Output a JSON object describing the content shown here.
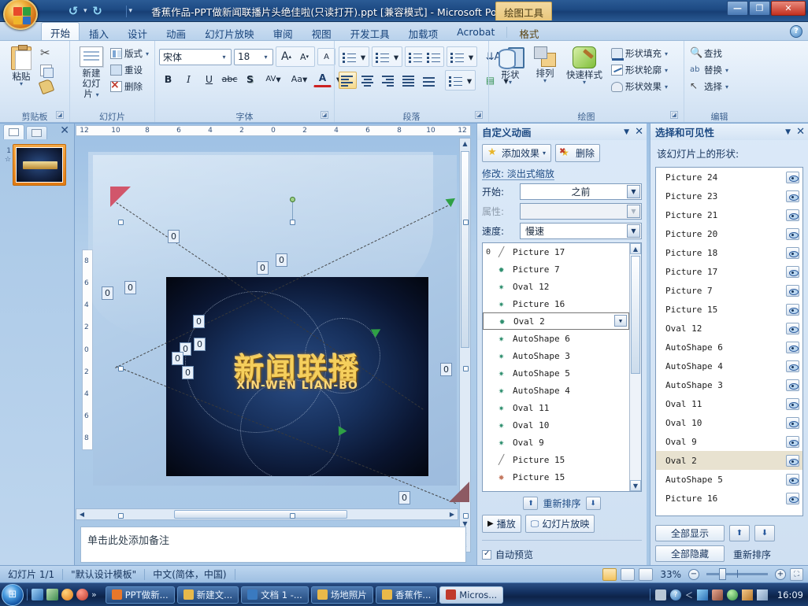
{
  "titlebar": {
    "document_title": "香蕉作品-PPT做新闻联播片头绝佳啦(只读打开).ppt [兼容模式] - Microsoft PowerPoi...",
    "contextual_tab": "绘图工具",
    "quick_access": [
      "save-icon",
      "undo-icon",
      "redo-icon",
      "new-icon"
    ],
    "minimize": "—",
    "restore": "❐",
    "close": "✕"
  },
  "tabs": [
    {
      "label": "开始",
      "active": true
    },
    {
      "label": "插入",
      "active": false
    },
    {
      "label": "设计",
      "active": false
    },
    {
      "label": "动画",
      "active": false
    },
    {
      "label": "幻灯片放映",
      "active": false
    },
    {
      "label": "审阅",
      "active": false
    },
    {
      "label": "视图",
      "active": false
    },
    {
      "label": "开发工具",
      "active": false
    },
    {
      "label": "加载项",
      "active": false
    },
    {
      "label": "Acrobat",
      "active": false
    },
    {
      "label": "格式",
      "active": false
    }
  ],
  "ribbon": {
    "clipboard": {
      "group_label": "剪贴板",
      "paste": "粘贴",
      "cut": "剪切",
      "copy": "复制",
      "format_painter": "格式刷"
    },
    "slides": {
      "group_label": "幻灯片",
      "new_slide_line1": "新建",
      "new_slide_line2": "幻灯片",
      "layout": "版式",
      "reset": "重设",
      "delete": "删除"
    },
    "font": {
      "group_label": "字体",
      "font_name": "宋体",
      "font_size": "18",
      "grow": "A",
      "shrink": "A",
      "clear_format": "A",
      "bold": "B",
      "italic": "I",
      "underline": "U",
      "strike": "abc",
      "shadow": "S",
      "spacing": "AV",
      "case": "Aa",
      "color": "A"
    },
    "paragraph": {
      "group_label": "段落"
    },
    "drawing": {
      "group_label": "绘图",
      "shapes": "形状",
      "arrange": "排列",
      "quick_styles": "快速样式",
      "shape_fill": "形状填充",
      "shape_outline": "形状轮廓",
      "shape_effects": "形状效果"
    },
    "editing": {
      "group_label": "编辑",
      "find": "查找",
      "replace": "替换",
      "select": "选择"
    }
  },
  "slides_pane": {
    "tab_slides": "slides-tab",
    "tab_outline": "outline-tab",
    "close": "✕",
    "thumbnails": [
      {
        "number": "1",
        "title": "新闻联播"
      }
    ]
  },
  "editor": {
    "h_ruler_ticks": [
      "12",
      "10",
      "8",
      "6",
      "4",
      "2",
      "0",
      "2",
      "4",
      "6",
      "8",
      "10",
      "12"
    ],
    "v_ruler_ticks": [
      "8",
      "6",
      "4",
      "2",
      "0",
      "2",
      "4",
      "6",
      "8"
    ],
    "slide": {
      "picture_title": "新闻联播",
      "picture_subtitle": "XIN-WEN LIAN-BO"
    },
    "animation_badges": [
      "0",
      "0",
      "0",
      "0",
      "0",
      "0",
      "0",
      "0",
      "0",
      "0",
      "0",
      "0"
    ],
    "notes_placeholder": "单击此处添加备注"
  },
  "animation_pane": {
    "title": "自定义动画",
    "collapse": "▼",
    "close": "✕",
    "add_effect": "添加效果",
    "remove": "删除",
    "modify_label": "修改: 淡出式缩放",
    "start_label": "开始:",
    "start_value": "之前",
    "property_label": "属性:",
    "property_value": "",
    "speed_label": "速度:",
    "speed_value": "慢速",
    "items": [
      {
        "order": "0",
        "name": "Picture 17",
        "icon": "motion-path-icon",
        "selected": false
      },
      {
        "order": "",
        "name": "Picture 7",
        "icon": "emphasis-star-icon",
        "selected": false
      },
      {
        "order": "",
        "name": "Oval 12",
        "icon": "entrance-star-icon",
        "selected": false
      },
      {
        "order": "",
        "name": "Picture 16",
        "icon": "entrance-star-icon",
        "selected": false
      },
      {
        "order": "",
        "name": "Oval 2",
        "icon": "emphasis-star-icon",
        "selected": true
      },
      {
        "order": "",
        "name": "AutoShape 6",
        "icon": "entrance-star-icon",
        "selected": false
      },
      {
        "order": "",
        "name": "AutoShape 3",
        "icon": "entrance-star-icon",
        "selected": false
      },
      {
        "order": "",
        "name": "AutoShape 5",
        "icon": "entrance-star-icon",
        "selected": false
      },
      {
        "order": "",
        "name": "AutoShape 4",
        "icon": "entrance-star-icon",
        "selected": false
      },
      {
        "order": "",
        "name": "Oval 11",
        "icon": "entrance-star-icon",
        "selected": false
      },
      {
        "order": "",
        "name": "Oval 10",
        "icon": "entrance-star-icon",
        "selected": false
      },
      {
        "order": "",
        "name": "Oval 9",
        "icon": "entrance-star-icon",
        "selected": false
      },
      {
        "order": "",
        "name": "Picture 15",
        "icon": "motion-path-icon",
        "selected": false
      },
      {
        "order": "",
        "name": "Picture 15",
        "icon": "exit-star-icon",
        "selected": false
      }
    ],
    "reorder_label": "重新排序",
    "play": "播放",
    "slideshow": "幻灯片放映",
    "autopreview": "自动预览"
  },
  "selection_pane": {
    "title": "选择和可见性",
    "collapse": "▼",
    "close": "✕",
    "subtitle": "该幻灯片上的形状:",
    "shapes": [
      {
        "name": "Picture 24",
        "visible": true,
        "highlighted": false
      },
      {
        "name": "Picture 23",
        "visible": true,
        "highlighted": false
      },
      {
        "name": "Picture 21",
        "visible": true,
        "highlighted": false
      },
      {
        "name": "Picture 20",
        "visible": true,
        "highlighted": false
      },
      {
        "name": "Picture 18",
        "visible": true,
        "highlighted": false
      },
      {
        "name": "Picture 17",
        "visible": true,
        "highlighted": false
      },
      {
        "name": "Picture 7",
        "visible": true,
        "highlighted": false
      },
      {
        "name": "Picture 15",
        "visible": true,
        "highlighted": false
      },
      {
        "name": "Oval 12",
        "visible": true,
        "highlighted": false
      },
      {
        "name": "AutoShape 6",
        "visible": true,
        "highlighted": false
      },
      {
        "name": "AutoShape 4",
        "visible": true,
        "highlighted": false
      },
      {
        "name": "AutoShape 3",
        "visible": true,
        "highlighted": false
      },
      {
        "name": "Oval 11",
        "visible": true,
        "highlighted": false
      },
      {
        "name": "Oval 10",
        "visible": true,
        "highlighted": false
      },
      {
        "name": "Oval 9",
        "visible": true,
        "highlighted": false
      },
      {
        "name": "Oval 2",
        "visible": true,
        "highlighted": true
      },
      {
        "name": "AutoShape 5",
        "visible": true,
        "highlighted": false
      },
      {
        "name": "Picture 16",
        "visible": true,
        "highlighted": false
      }
    ],
    "show_all": "全部显示",
    "hide_all": "全部隐藏",
    "reorder": "重新排序"
  },
  "statusbar": {
    "slide_count": "幻灯片 1/1",
    "template": "\"默认设计模板\"",
    "language": "中文(简体，中国)",
    "zoom": "33%",
    "zoom_out": "−",
    "zoom_in": "+"
  },
  "taskbar": {
    "start": "start-orb",
    "items": [
      {
        "label": "PPT做新...",
        "active": false,
        "color": "#e8772a"
      },
      {
        "label": "新建文...",
        "active": false,
        "color": "#e8b94a"
      },
      {
        "label": "文档 1 -...",
        "active": false,
        "color": "#3a7ac0"
      },
      {
        "label": "场地照片",
        "active": false,
        "color": "#e8b94a"
      },
      {
        "label": "香蕉作...",
        "active": false,
        "color": "#e8b94a"
      },
      {
        "label": "Micros...",
        "active": true,
        "color": "#c0392b"
      }
    ],
    "clock": "16:09"
  }
}
